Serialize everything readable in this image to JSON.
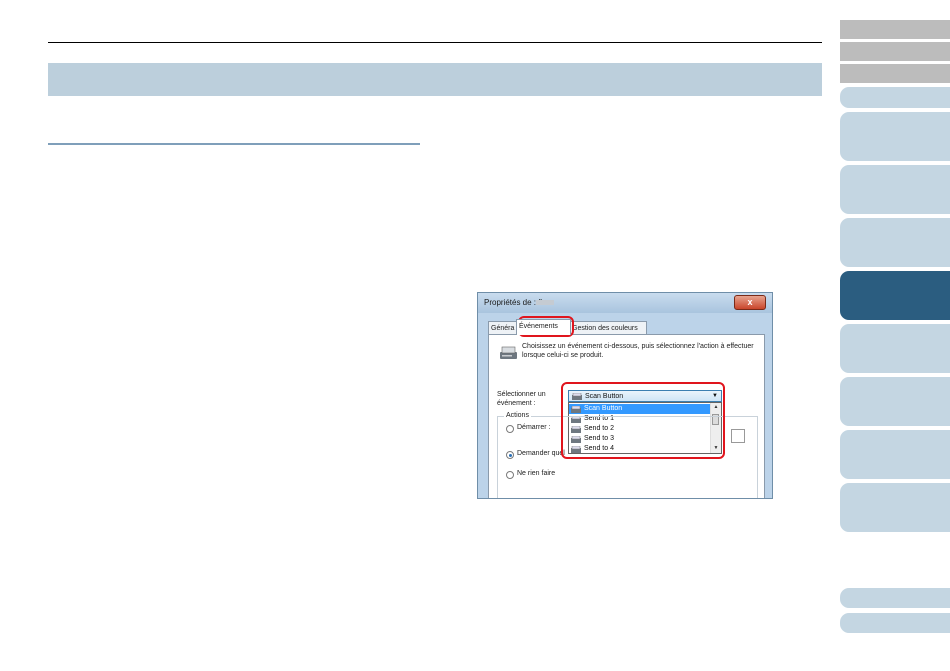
{
  "dialog": {
    "title": "Propriétés de : fi-",
    "close_symbol": "x",
    "tabs": [
      "Généra",
      "Événements",
      "Gestion des couleurs"
    ],
    "description": "Choisissez un événement ci-dessous, puis sélectionnez l'action à effectuer lorsque celui-ci se produit.",
    "select_label": "Sélectionner un événement :",
    "selected_value": "Scan Button",
    "list_items": [
      "Scan Button",
      "Send to 1",
      "Send to 2",
      "Send to 3",
      "Send to 4"
    ],
    "actions_label": "Actions",
    "radio_start": "Démarrer :",
    "radio_ask": "Demander quel",
    "radio_none": "Ne rien faire"
  },
  "colors": {
    "section_bar": "#bccfdc",
    "nav_tab": "#c4d6e2",
    "nav_tab_active": "#2b5d80",
    "nav_tab_gray": "#bcbcbc",
    "highlight": "#e0151d"
  }
}
